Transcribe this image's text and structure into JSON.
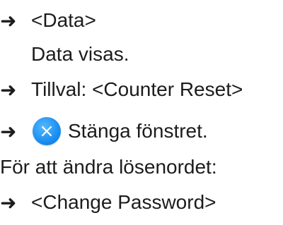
{
  "lines": [
    {
      "text": "<Data>"
    },
    {
      "text": "Data visas."
    },
    {
      "text": "Tillval: <Counter Reset>"
    },
    {
      "text": "Stänga fönstret."
    },
    {
      "text": "För att ändra lösenordet:"
    },
    {
      "text": "<Change Password>"
    }
  ],
  "arrow_glyph": "➜",
  "icons": {
    "close": "close-icon",
    "arrow": "arrow-right-icon"
  },
  "colors": {
    "close_button": "#1a8ef0",
    "text": "#1c1c1c"
  }
}
